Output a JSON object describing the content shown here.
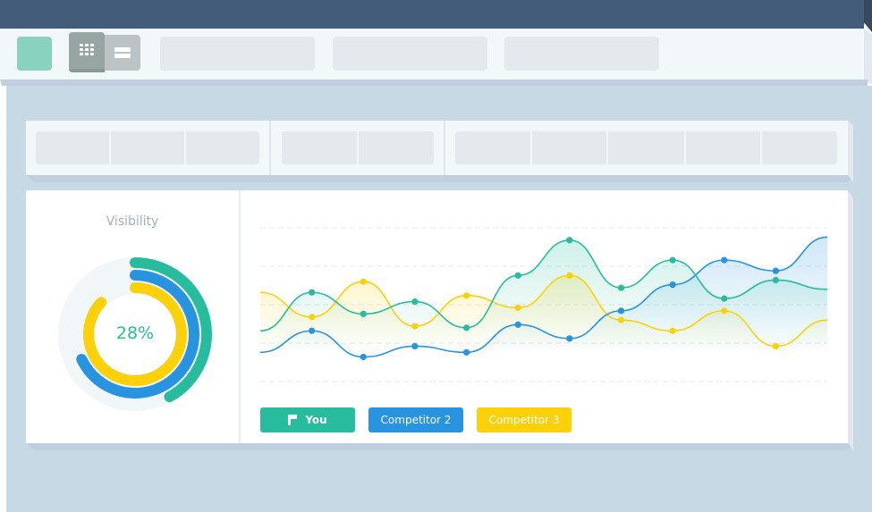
{
  "window": {
    "colors": {
      "titlebar": "#425c79",
      "toolbar": "#f2f7fa",
      "canvas": "#c7d9e4"
    }
  },
  "toolbar": {
    "logo": "app-logo",
    "view_toggle": {
      "options": [
        "grid-view",
        "list-view"
      ],
      "selected": "grid-view"
    },
    "placeholder_tabs": 3
  },
  "filter_bar": {
    "groups": [
      {
        "cells": 3
      },
      {
        "cells": 2
      },
      {
        "cells": 5
      }
    ]
  },
  "visibility": {
    "title": "Visibility",
    "value_label": "28%",
    "rings": [
      {
        "name": "You",
        "color": "#27bc9d",
        "fraction": 0.42
      },
      {
        "name": "Competitor 2",
        "color": "#2893de",
        "fraction": 0.68
      },
      {
        "name": "Competitor 3",
        "color": "#fdd10a",
        "fraction": 0.87
      }
    ]
  },
  "legend": {
    "you": "You",
    "competitor_2": "Competitor 2",
    "competitor_3": "Competitor 3"
  },
  "chart_data": {
    "type": "line",
    "title": "",
    "xlabel": "",
    "ylabel": "",
    "ylim": [
      0,
      100
    ],
    "grid": true,
    "gridlines": [
      0,
      25,
      50,
      75,
      100
    ],
    "smooth": true,
    "x": [
      0,
      1,
      2,
      3,
      4,
      5,
      6,
      7,
      8,
      9,
      10,
      11
    ],
    "series": [
      {
        "name": "You",
        "color": "#27bc9d",
        "values": [
          33,
          58,
          44,
          52,
          35,
          69,
          92,
          61,
          79,
          54,
          66,
          60
        ],
        "markers": [
          1,
          2,
          3,
          4,
          5,
          6,
          7,
          8,
          9,
          10
        ]
      },
      {
        "name": "Competitor 2",
        "color": "#2893de",
        "values": [
          19,
          33,
          16,
          23,
          19,
          37,
          28,
          46,
          63,
          79,
          72,
          94
        ],
        "markers": [
          1,
          2,
          3,
          4,
          5,
          6,
          7,
          8,
          9,
          10
        ]
      },
      {
        "name": "Competitor 3",
        "color": "#fdd10a",
        "values": [
          58,
          42,
          65,
          36,
          56,
          48,
          69,
          40,
          33,
          46,
          23,
          40
        ],
        "markers": [
          1,
          2,
          3,
          4,
          5,
          6,
          7,
          8,
          9,
          10
        ]
      }
    ],
    "legend_position": "bottom-left"
  }
}
